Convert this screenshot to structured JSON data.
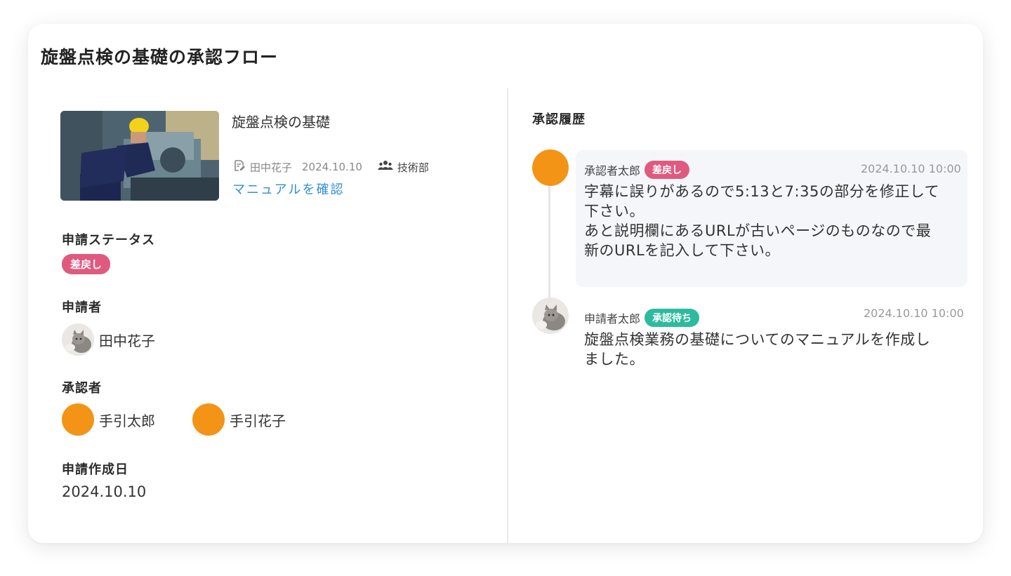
{
  "page": {
    "title": "旋盤点検の基礎の承認フロー"
  },
  "manual": {
    "title": "旋盤点検の基礎",
    "author": "田中花子",
    "date": "2024.10.10",
    "department": "技術部",
    "link_label": "マニュアルを確認"
  },
  "status": {
    "label": "申請ステータス",
    "badge": "差戻し",
    "badge_color": "#e05a80"
  },
  "applicant": {
    "label": "申請者",
    "name": "田中花子"
  },
  "approvers": {
    "label": "承認者",
    "list": [
      {
        "name": "手引太郎",
        "avatar_color": "#f39416"
      },
      {
        "name": "手引花子",
        "avatar_color": "#f39416"
      }
    ]
  },
  "created": {
    "label": "申請作成日",
    "value": "2024.10.10"
  },
  "history": {
    "title": "承認履歴",
    "entries": [
      {
        "author": "承認者太郎",
        "badge": "差戻し",
        "badge_color": "#e05a80",
        "time": "2024.10.10 10:00",
        "body_lines": [
          "字幕に誤りがあるので5:13と7:35の部分を修正して",
          "下さい。",
          "あと説明欄にあるURLが古いページのものなので最",
          "新のURLを記入して下さい。"
        ],
        "avatar_color": "#f39416"
      },
      {
        "author": "申請者太郎",
        "badge": "承認待ち",
        "badge_color": "#2dbba0",
        "time": "2024.10.10 10:00",
        "body_lines": [
          "旋盤点検業務の基礎についてのマニュアルを作成し",
          "ました。"
        ],
        "avatar_icon": "cat-photo"
      }
    ]
  },
  "colors": {
    "accent_orange": "#f39416",
    "link_blue": "#2f8fd8",
    "reject_pink": "#e05a80",
    "pending_green": "#2dbba0"
  }
}
